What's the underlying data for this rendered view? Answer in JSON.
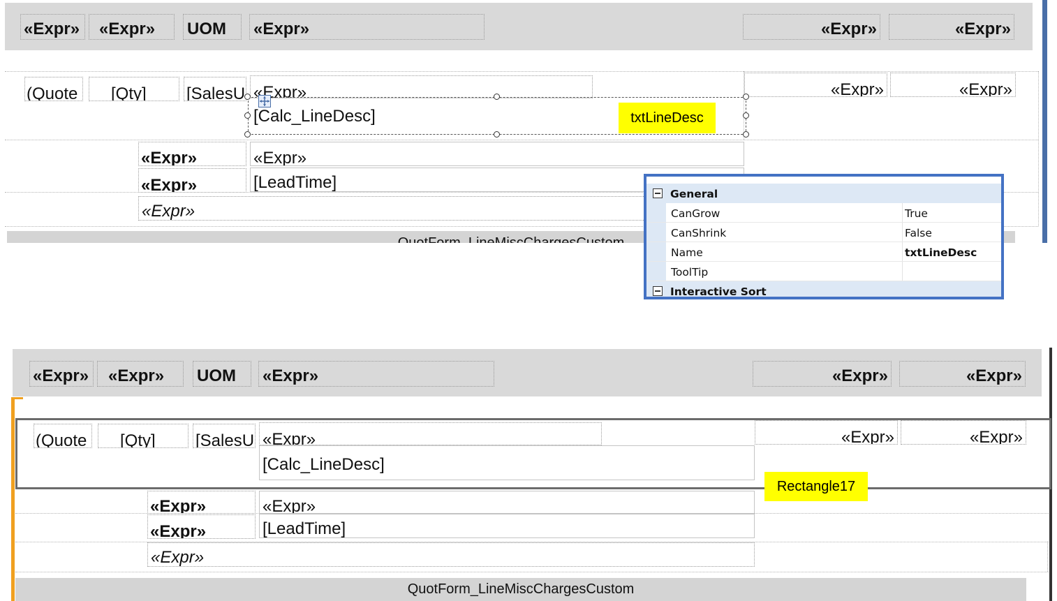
{
  "designer": {
    "top": {
      "header": [
        "«Expr»",
        "«Expr»",
        "UOM",
        "«Expr»",
        "«Expr»",
        "«Expr»"
      ],
      "line_row": [
        "(Quote",
        "[Qty]",
        "[SalesU",
        "«Expr»",
        "«Expr»",
        "«Expr»"
      ],
      "calc_line_desc": "[Calc_LineDesc]",
      "rows": {
        "expr_bold_1": "«Expr»",
        "expr_plain": "«Expr»",
        "expr_bold_2": "«Expr»",
        "lead_time": "[LeadTime]",
        "expr_italic": "«Expr»"
      },
      "subreport": "QuotForm_LineMiscChargesCustom"
    },
    "bottom": {
      "header": [
        "«Expr»",
        "«Expr»",
        "UOM",
        "«Expr»",
        "«Expr»",
        "«Expr»"
      ],
      "line_row": [
        "(Quote",
        "[Qty]",
        "[SalesU",
        "«Expr»",
        "«Expr»",
        "«Expr»"
      ],
      "calc_line_desc": "[Calc_LineDesc]",
      "rows": {
        "expr_bold_1": "«Expr»",
        "expr_plain": "«Expr»",
        "expr_bold_2": "«Expr»",
        "lead_time": "[LeadTime]",
        "expr_italic": "«Expr»"
      },
      "subreport": "QuotForm_LineMiscChargesCustom"
    }
  },
  "callouts": {
    "textbox": "txtLineDesc",
    "rectangle": "Rectangle17"
  },
  "properties": {
    "general": "General",
    "items": [
      {
        "name": "CanGrow",
        "value": "True"
      },
      {
        "name": "CanShrink",
        "value": "False"
      },
      {
        "name": "Name",
        "value": "txtLineDesc"
      },
      {
        "name": "ToolTip",
        "value": ""
      }
    ],
    "interactive_sort": "Interactive Sort"
  },
  "colors": {
    "callout": "#ffff00",
    "property_border": "#4472c4",
    "rectangle_border": "#6b6b6b",
    "container_selection": "#f0a020"
  }
}
